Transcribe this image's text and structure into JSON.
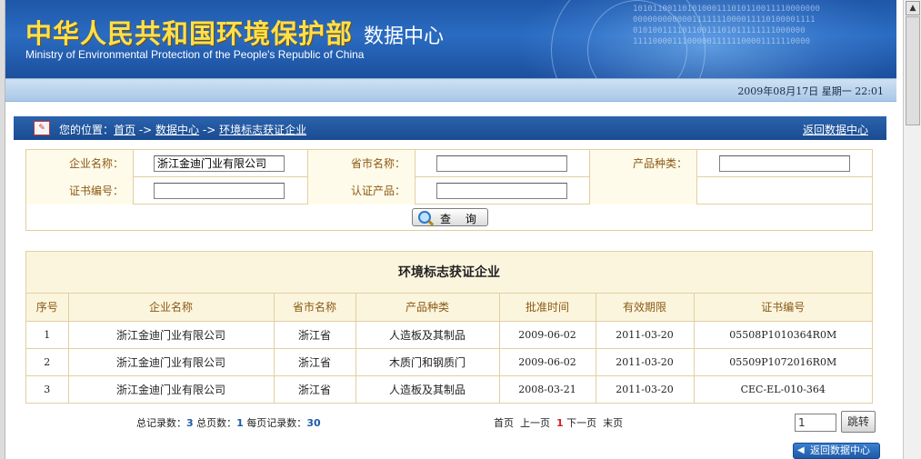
{
  "header": {
    "title_cn": "中华人民共和国环境保护部",
    "subtitle": "数据中心",
    "title_en": "Ministry of Environmental Protection of the People's Republic of China"
  },
  "datebar": {
    "text": "2009年08月17日  星期一  22:01"
  },
  "breadcrumb": {
    "prefix": "您的位置：",
    "home": "首页",
    "sep1": " -> ",
    "data_center": "数据中心",
    "sep2": " -> ",
    "current": "环境标志获证企业",
    "back_link": "返回数据中心"
  },
  "search": {
    "company_label": "企业名称：",
    "company_value": "浙江金迪门业有限公司",
    "province_label": "省市名称：",
    "province_value": "",
    "product_type_label": "产品种类：",
    "product_type_value": "",
    "cert_no_label": "证书编号：",
    "cert_no_value": "",
    "cert_product_label": "认证产品：",
    "cert_product_value": "",
    "query_button": "查 询"
  },
  "results": {
    "title": "环境标志获证企业",
    "columns": [
      "序号",
      "企业名称",
      "省市名称",
      "产品种类",
      "批准时间",
      "有效期限",
      "证书编号"
    ],
    "rows": [
      [
        "1",
        "浙江金迪门业有限公司",
        "浙江省",
        "人造板及其制品",
        "2009-06-02",
        "2011-03-20",
        "05508P1010364R0M"
      ],
      [
        "2",
        "浙江金迪门业有限公司",
        "浙江省",
        "木质门和钢质门",
        "2009-06-02",
        "2011-03-20",
        "05509P1072016R0M"
      ],
      [
        "3",
        "浙江金迪门业有限公司",
        "浙江省",
        "人造板及其制品",
        "2008-03-21",
        "2011-03-20",
        "CEC-EL-010-364"
      ]
    ]
  },
  "pager": {
    "total_label": "总记录数：",
    "total": "3",
    "pages_label": "总页数：",
    "pages": "1",
    "per_page_label": "每页记录数：",
    "per_page": "30",
    "first": "首页",
    "prev": "上一页",
    "current": "1",
    "next": "下一页",
    "last": "末页",
    "jump_value": "1",
    "jump_button": "跳转",
    "back_button": "返回数据中心"
  },
  "colors": {
    "banner_blue": "#2a6cc2",
    "title_gold": "#ffe04a",
    "border_tan": "#e2cfa0",
    "label_brown": "#8b5a14",
    "link_blue": "#1d5ba8",
    "current_red": "#d81f1f"
  },
  "icons": {
    "breadcrumb": "location-icon",
    "query": "magnifier-icon",
    "back": "left-arrow-icon"
  }
}
